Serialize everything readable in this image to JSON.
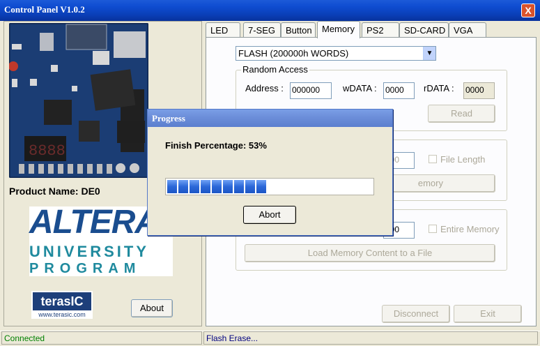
{
  "window": {
    "title": "Control Panel V1.0.2",
    "close_label": "X"
  },
  "left_panel": {
    "product_name": "Product Name: DE0",
    "altera_logo": {
      "wordmark": "ALTERA",
      "line1": "UNIVERSITY",
      "line2": "PROGRAM"
    },
    "terasic_logo": {
      "wordmark": "terasIC",
      "url": "www.terasic.com"
    },
    "about_label": "About"
  },
  "tabs": [
    {
      "label": "LED"
    },
    {
      "label": "7-SEG"
    },
    {
      "label": "Button"
    },
    {
      "label": "Memory",
      "active": true
    },
    {
      "label": "PS2"
    },
    {
      "label": "SD-CARD"
    },
    {
      "label": "VGA"
    }
  ],
  "memory": {
    "memory_type": "FLASH (200000h WORDS)",
    "random_access": {
      "title": "Random Access",
      "address_label": "Address :",
      "address_value": "000000",
      "wdata_label": "wDATA :",
      "wdata_value": "0000",
      "rdata_label": "rDATA :",
      "rdata_value": "0000",
      "read_label": "Read"
    },
    "sequential_write": {
      "length_value": "000",
      "file_length_label": "File Length",
      "write_label": "emory"
    },
    "sequential_read": {
      "length_value": "000",
      "entire_memory_label": "Entire Memory",
      "load_label": "Load Memory Content to a File"
    },
    "disconnect_label": "Disconnect",
    "exit_label": "Exit"
  },
  "status": {
    "left": "Connected",
    "right": "Flash Erase..."
  },
  "progress_dialog": {
    "title": "Progress",
    "percent_text": "Finish Percentage: 53%",
    "percent": 53,
    "abort_label": "Abort"
  },
  "colors": {
    "titlebar": "#0f4dd1",
    "progress_fill": "#2b68d8",
    "status_ok": "#008000"
  }
}
